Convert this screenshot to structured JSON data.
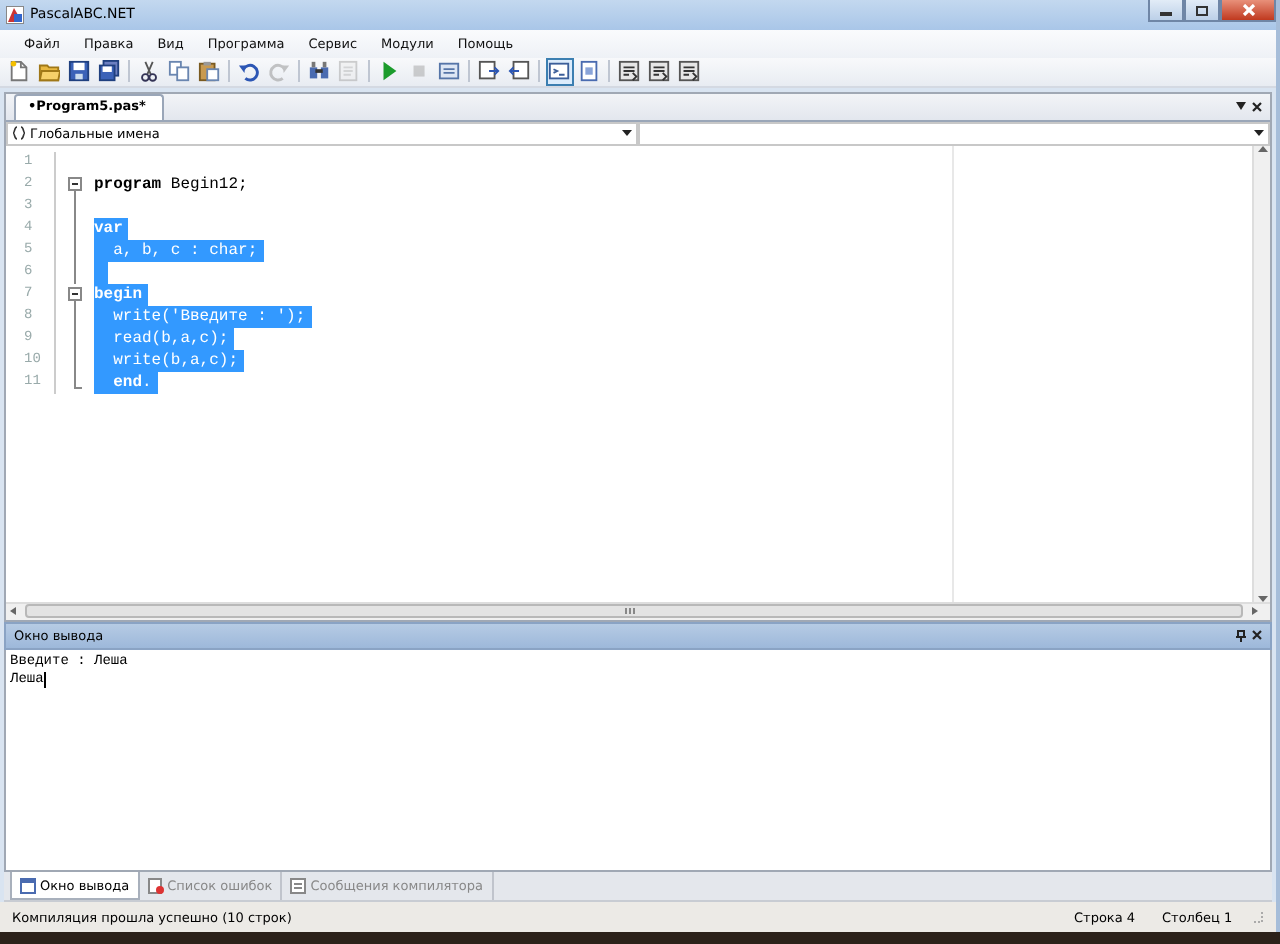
{
  "window": {
    "title": "PascalABC.NET"
  },
  "menu": [
    "Файл",
    "Правка",
    "Вид",
    "Программа",
    "Сервис",
    "Модули",
    "Помощь"
  ],
  "toolbar": [
    {
      "kind": "new",
      "pressed": false,
      "disabled": false
    },
    {
      "kind": "open",
      "pressed": false,
      "disabled": false
    },
    {
      "kind": "save",
      "pressed": false,
      "disabled": false
    },
    {
      "kind": "save-all",
      "pressed": false,
      "disabled": false
    },
    {
      "kind": "separator"
    },
    {
      "kind": "cut",
      "pressed": false,
      "disabled": false
    },
    {
      "kind": "copy",
      "pressed": false,
      "disabled": false
    },
    {
      "kind": "paste",
      "pressed": false,
      "disabled": false
    },
    {
      "kind": "separator"
    },
    {
      "kind": "undo",
      "pressed": false,
      "disabled": false
    },
    {
      "kind": "redo",
      "pressed": false,
      "disabled": true
    },
    {
      "kind": "separator"
    },
    {
      "kind": "find",
      "pressed": false,
      "disabled": false
    },
    {
      "kind": "replace",
      "pressed": false,
      "disabled": true
    },
    {
      "kind": "separator"
    },
    {
      "kind": "run",
      "pressed": false,
      "disabled": false
    },
    {
      "kind": "stop",
      "pressed": false,
      "disabled": true
    },
    {
      "kind": "compile",
      "pressed": false,
      "disabled": false
    },
    {
      "kind": "separator"
    },
    {
      "kind": "comment",
      "pressed": false,
      "disabled": false
    },
    {
      "kind": "uncomment",
      "pressed": false,
      "disabled": false
    },
    {
      "kind": "separator"
    },
    {
      "kind": "console",
      "pressed": true,
      "disabled": false
    },
    {
      "kind": "form",
      "pressed": false,
      "disabled": false
    },
    {
      "kind": "separator"
    },
    {
      "kind": "step",
      "pressed": false,
      "disabled": false
    },
    {
      "kind": "step",
      "pressed": false,
      "disabled": false
    },
    {
      "kind": "step",
      "pressed": false,
      "disabled": false
    }
  ],
  "document_tabs": [
    {
      "label": "•Program5.pas*",
      "selected": true
    }
  ],
  "names_combo": {
    "value": "Глобальные имена"
  },
  "editor": {
    "lines": [
      {
        "number": "1",
        "kind": "plain",
        "selected": false
      },
      {
        "number": "2",
        "text": "**program** Begin12;",
        "kind": "foldstart",
        "selected": false
      },
      {
        "number": "3",
        "kind": "foldbody",
        "selected": false
      },
      {
        "number": "4",
        "text": "**var**",
        "kind": "foldbody",
        "selected": true
      },
      {
        "number": "5",
        "text": "  a, b, c : char;",
        "kind": "foldbody",
        "selected": true
      },
      {
        "number": "6",
        "kind": "foldbody",
        "selected": true
      },
      {
        "number": "7",
        "text": "**begin**",
        "kind": "foldstart",
        "selected": true
      },
      {
        "number": "8",
        "text": "  write('Введите : ');",
        "kind": "foldbody",
        "selected": true
      },
      {
        "number": "9",
        "text": "  read(b,a,c);",
        "kind": "foldbody",
        "selected": true
      },
      {
        "number": "10",
        "text": "  write(b,a,c);",
        "kind": "foldbody",
        "selected": true
      },
      {
        "number": "11",
        "text": "  **end**.",
        "kind": "foldend",
        "selected": true
      }
    ]
  },
  "output": {
    "title": "Окно вывода",
    "lines": [
      "Введите : Леша",
      "Леша"
    ]
  },
  "bottom_tabs": [
    {
      "label": "Окно вывода",
      "kind": "output",
      "selected": true
    },
    {
      "label": "Список ошибок",
      "kind": "errors",
      "selected": false
    },
    {
      "label": "Сообщения компилятора",
      "kind": "messages",
      "selected": false
    }
  ],
  "status_bar": {
    "message": "Компиляция прошла успешно (10 строк)",
    "line": "Строка 4",
    "column": "Столбец 1"
  }
}
